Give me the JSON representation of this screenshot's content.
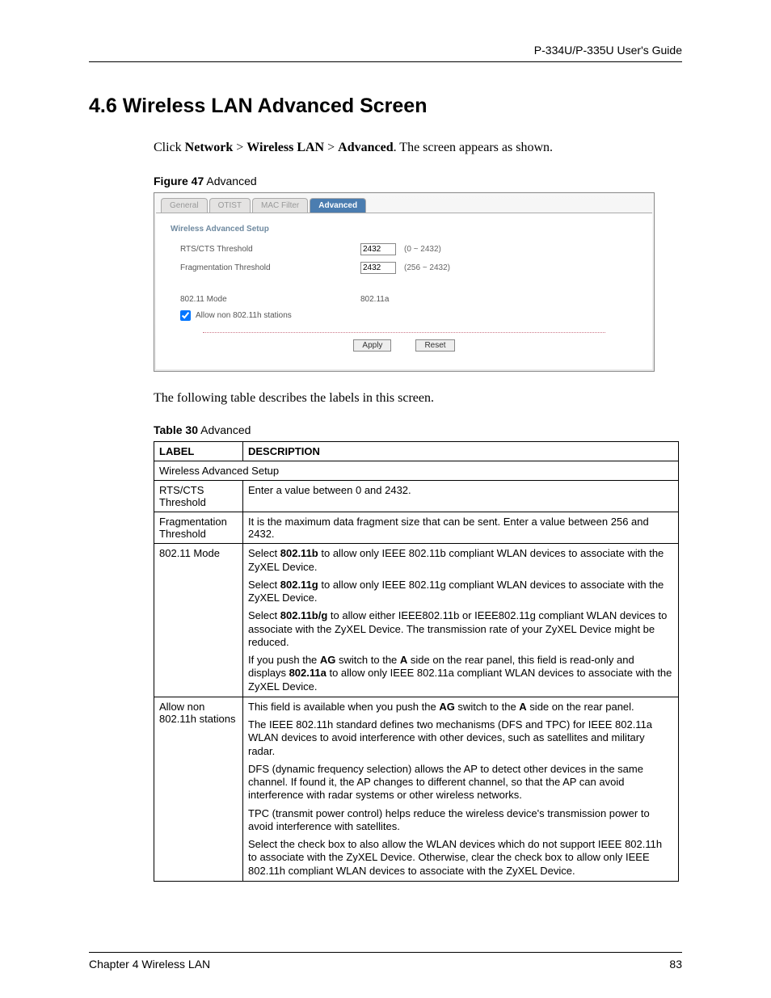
{
  "header": {
    "guide": "P-334U/P-335U User's Guide"
  },
  "section": {
    "title": "4.6  Wireless LAN Advanced Screen"
  },
  "intro": {
    "prefix": "Click ",
    "nav1": "Network",
    "sep1": " > ",
    "nav2": "Wireless LAN",
    "sep2": " > ",
    "nav3": "Advanced",
    "suffix": ". The screen appears as shown."
  },
  "figure": {
    "label": "Figure 47",
    "title": "   Advanced"
  },
  "screenshot": {
    "tabs": [
      "General",
      "OTIST",
      "MAC Filter",
      "Advanced"
    ],
    "active_tab_index": 3,
    "section_h": "Wireless Advanced Setup",
    "rts_label": "RTS/CTS Threshold",
    "rts_value": "2432",
    "rts_range": "(0 ~ 2432)",
    "frag_label": "Fragmentation Threshold",
    "frag_value": "2432",
    "frag_range": "(256 ~ 2432)",
    "mode_label": "802.11 Mode",
    "mode_value": "802.11a",
    "checkbox_label": "Allow non 802.11h stations",
    "checkbox_checked": true,
    "apply_btn": "Apply",
    "reset_btn": "Reset"
  },
  "post_figure": "The following table describes the labels in this screen.",
  "table_caption": {
    "label": "Table 30",
    "title": "   Advanced"
  },
  "table": {
    "headers": [
      "LABEL",
      "DESCRIPTION"
    ],
    "section_row": "Wireless Advanced Setup",
    "rows": {
      "rts": {
        "label": "RTS/CTS Threshold",
        "desc": "Enter a value between 0 and 2432."
      },
      "frag": {
        "label": "Fragmentation Threshold",
        "desc": "It is the maximum data fragment size that can be sent. Enter a value between 256 and 2432."
      },
      "mode": {
        "label": "802.11 Mode",
        "p1a": "Select ",
        "p1b": "802.11b",
        "p1c": " to allow only IEEE 802.11b compliant WLAN devices to associate with the ZyXEL Device.",
        "p2a": "Select ",
        "p2b": "802.11g",
        "p2c": " to allow only IEEE 802.11g compliant WLAN devices to associate with the ZyXEL Device.",
        "p3a": "Select ",
        "p3b": "802.11b/g",
        "p3c": " to allow either IEEE802.11b or IEEE802.11g compliant WLAN devices to associate with the ZyXEL Device. The transmission rate of your ZyXEL Device might be reduced.",
        "p4a": "If you push the ",
        "p4b": "AG",
        "p4c": " switch to the ",
        "p4d": "A",
        "p4e": " side on the rear panel, this field is read-only and displays ",
        "p4f": "802.11a",
        "p4g": " to allow only IEEE 802.11a compliant WLAN devices to associate with the ZyXEL Device."
      },
      "allow": {
        "label": "Allow non 802.11h stations",
        "p1a": "This field is available when you push the ",
        "p1b": "AG",
        "p1c": " switch to the ",
        "p1d": "A",
        "p1e": " side on the rear panel.",
        "p2": "The IEEE 802.11h standard defines two mechanisms (DFS and TPC) for IEEE 802.11a WLAN devices to avoid interference with other devices, such as satellites and military radar.",
        "p3": "DFS (dynamic frequency selection) allows the AP to detect other devices in the same channel. If found it, the AP changes to different channel, so that the AP can avoid interference with radar systems or other wireless networks.",
        "p4": "TPC (transmit power control) helps reduce the wireless device's transmission power to avoid interference with satellites.",
        "p5": "Select the check box to also allow the WLAN devices which do not support IEEE 802.11h to associate with the ZyXEL Device. Otherwise, clear the check box to allow only IEEE 802.11h compliant WLAN devices to associate with the ZyXEL Device."
      }
    }
  },
  "footer": {
    "chapter": "Chapter 4 Wireless LAN",
    "page": "83"
  }
}
